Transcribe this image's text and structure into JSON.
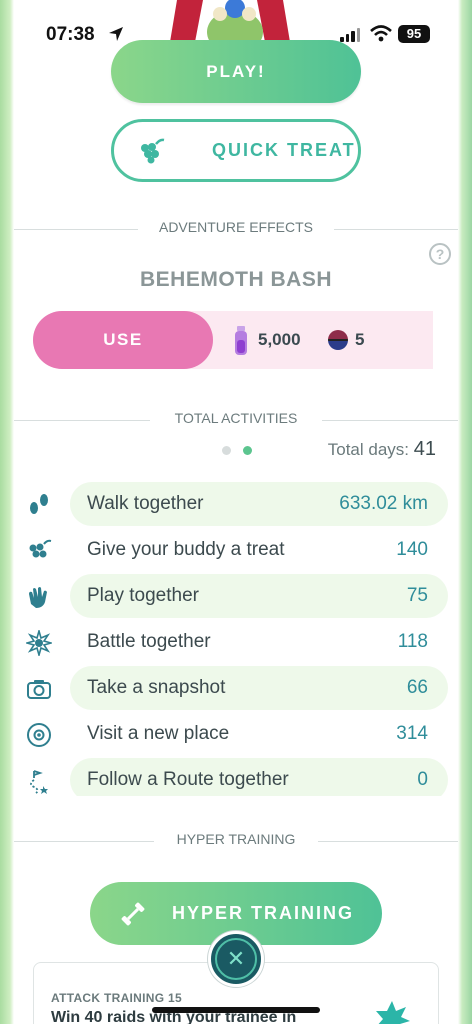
{
  "status_bar": {
    "time": "07:38",
    "battery": "95"
  },
  "buttons": {
    "play": "PLAY!",
    "quick_treat": "QUICK TREAT",
    "use": "USE",
    "hyper_training": "HYPER TRAINING"
  },
  "adventure_effects": {
    "header": "ADVENTURE EFFECTS",
    "help": "?",
    "effect_name": "BEHEMOTH BASH",
    "cost_potion": "5,000",
    "cost_ball": "5"
  },
  "total_activities": {
    "header": "TOTAL ACTIVITIES",
    "page_count": 2,
    "active_page": 2,
    "total_days_label": "Total days:",
    "total_days_value": "41",
    "items": [
      {
        "icon": "footprints-icon",
        "label": "Walk together",
        "value": "633.02 km",
        "highlighted": true
      },
      {
        "icon": "berries-icon",
        "label": "Give your buddy a treat",
        "value": "140",
        "highlighted": false
      },
      {
        "icon": "wave-hand-icon",
        "label": "Play together",
        "value": "75",
        "highlighted": true
      },
      {
        "icon": "battle-icon",
        "label": "Battle together",
        "value": "118",
        "highlighted": false
      },
      {
        "icon": "camera-icon",
        "label": "Take a snapshot",
        "value": "66",
        "highlighted": true
      },
      {
        "icon": "pokestop-icon",
        "label": "Visit a new place",
        "value": "314",
        "highlighted": false
      },
      {
        "icon": "route-icon",
        "label": "Follow a Route together",
        "value": "0",
        "highlighted": true
      }
    ]
  },
  "hyper_training": {
    "header": "HYPER TRAINING",
    "card_subtitle": "ATTACK TRAINING 15",
    "card_task": "Win 40 raids with your trainee in"
  },
  "colors": {
    "accent_green": "#4fc296",
    "teal_text": "#2f8d9a",
    "use_pink": "#e878b3",
    "row_highlight": "#eef9ea"
  }
}
